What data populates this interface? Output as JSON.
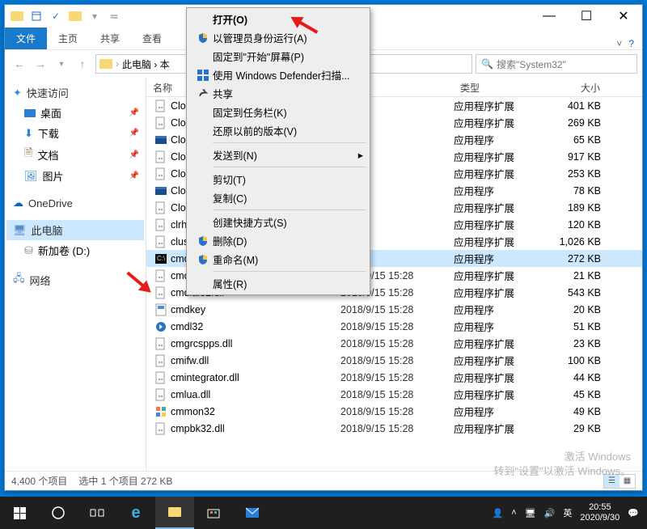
{
  "window": {
    "minimize": "—",
    "maximize": "☐",
    "close": "✕"
  },
  "ribbon": {
    "file": "文件",
    "home": "主页",
    "share": "共享",
    "view": "查看"
  },
  "address": {
    "back": "←",
    "fwd": "→",
    "down": "▾",
    "up": "↑",
    "path": "此电脑 › 本",
    "search_placeholder": "搜索\"System32\""
  },
  "sidebar": {
    "quick": "快速访问",
    "desktop": "桌面",
    "downloads": "下载",
    "documents": "文档",
    "pictures": "图片",
    "onedrive": "OneDrive",
    "thispc": "此电脑",
    "newvol": "新加卷 (D:)",
    "network": "网络"
  },
  "columns": {
    "name": "名称",
    "type": "类型",
    "size": "大小"
  },
  "files": [
    {
      "icon": "dll",
      "name": "Clou",
      "date": "5:28",
      "type": "应用程序扩展",
      "size": "401 KB"
    },
    {
      "icon": "dll",
      "name": "Clou",
      "date": "5:28",
      "type": "应用程序扩展",
      "size": "269 KB"
    },
    {
      "icon": "exe2",
      "name": "Clou",
      "date": "5:28",
      "type": "应用程序",
      "size": "65 KB"
    },
    {
      "icon": "dll",
      "name": "Clou",
      "date": "5:28",
      "type": "应用程序扩展",
      "size": "917 KB"
    },
    {
      "icon": "dll",
      "name": "Clou",
      "date": "5:28",
      "type": "应用程序扩展",
      "size": "253 KB"
    },
    {
      "icon": "exe2",
      "name": "Clou",
      "date": "5:28",
      "type": "应用程序",
      "size": "78 KB"
    },
    {
      "icon": "dll",
      "name": "Clou",
      "date": "5:28",
      "type": "应用程序扩展",
      "size": "189 KB"
    },
    {
      "icon": "dll",
      "name": "clrho",
      "date": "5:29",
      "type": "应用程序扩展",
      "size": "120 KB"
    },
    {
      "icon": "dll",
      "name": "clusa",
      "date": "5:29",
      "type": "应用程序扩展",
      "size": "1,026 KB"
    },
    {
      "icon": "cmd",
      "name": "cmd",
      "date": "5:28",
      "type": "应用程序",
      "size": "272 KB",
      "sel": true
    },
    {
      "icon": "dll",
      "name": "cmdext.dll",
      "date": "2018/9/15 15:28",
      "type": "应用程序扩展",
      "size": "21 KB"
    },
    {
      "icon": "dll",
      "name": "cmdial32.dll",
      "date": "2018/9/15 15:28",
      "type": "应用程序扩展",
      "size": "543 KB"
    },
    {
      "icon": "exe",
      "name": "cmdkey",
      "date": "2018/9/15 15:28",
      "type": "应用程序",
      "size": "20 KB"
    },
    {
      "icon": "exe3",
      "name": "cmdl32",
      "date": "2018/9/15 15:28",
      "type": "应用程序",
      "size": "51 KB"
    },
    {
      "icon": "dll",
      "name": "cmgrcspps.dll",
      "date": "2018/9/15 15:28",
      "type": "应用程序扩展",
      "size": "23 KB"
    },
    {
      "icon": "dll",
      "name": "cmifw.dll",
      "date": "2018/9/15 15:28",
      "type": "应用程序扩展",
      "size": "100 KB"
    },
    {
      "icon": "dll",
      "name": "cmintegrator.dll",
      "date": "2018/9/15 15:28",
      "type": "应用程序扩展",
      "size": "44 KB"
    },
    {
      "icon": "dll",
      "name": "cmlua.dll",
      "date": "2018/9/15 15:28",
      "type": "应用程序扩展",
      "size": "45 KB"
    },
    {
      "icon": "exe4",
      "name": "cmmon32",
      "date": "2018/9/15 15:28",
      "type": "应用程序",
      "size": "49 KB"
    },
    {
      "icon": "dll",
      "name": "cmpbk32.dll",
      "date": "2018/9/15 15:28",
      "type": "应用程序扩展",
      "size": "29 KB"
    }
  ],
  "status": {
    "count": "4,400 个项目",
    "selected": "选中 1 个项目   272 KB"
  },
  "context": {
    "open": "打开(O)",
    "runas": "以管理员身份运行(A)",
    "pin_start": "固定到\"开始\"屏幕(P)",
    "defender": "使用 Windows Defender扫描...",
    "share": "共享",
    "pin_task": "固定到任务栏(K)",
    "restore": "还原以前的版本(V)",
    "sendto": "发送到(N)",
    "cut": "剪切(T)",
    "copy": "复制(C)",
    "shortcut": "创建快捷方式(S)",
    "delete": "删除(D)",
    "rename": "重命名(M)",
    "props": "属性(R)"
  },
  "watermark": {
    "l1": "激活 Windows",
    "l2": "转到\"设置\"以激活 Windows。"
  },
  "taskbar": {
    "ime": "英",
    "time": "20:55",
    "date": "2020/9/30"
  }
}
